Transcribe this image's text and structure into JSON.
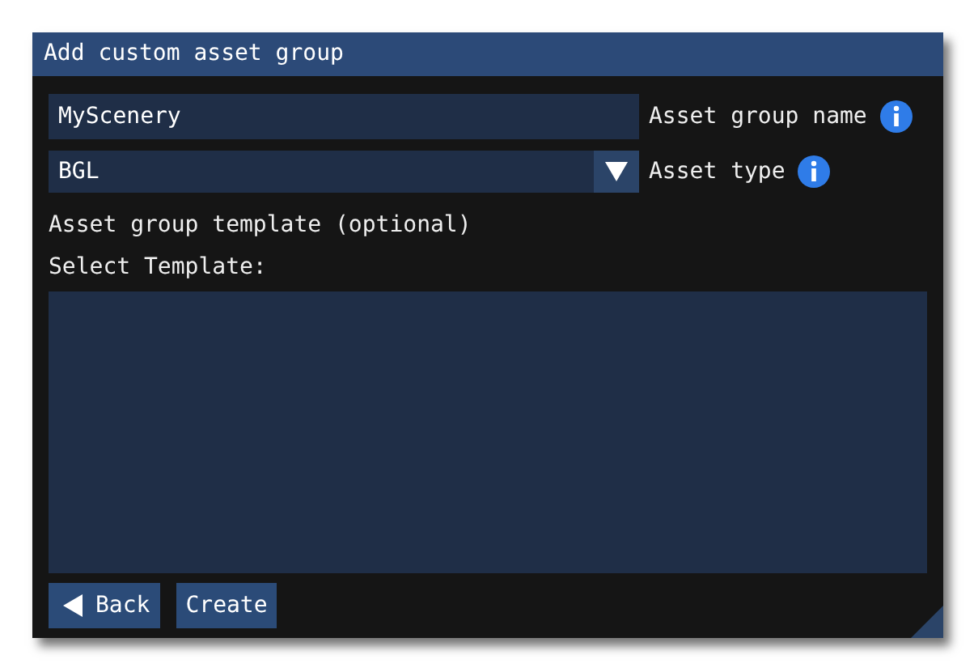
{
  "window": {
    "title": "Add custom asset group"
  },
  "fields": [
    {
      "kind": "text",
      "value": "MyScenery",
      "label": "Asset group name"
    },
    {
      "kind": "dropdown",
      "value": "BGL",
      "label": "Asset type"
    }
  ],
  "template_label": "Asset group template (optional)",
  "select_label": "Select Template:",
  "buttons": [
    {
      "kind": "back",
      "label": "Back"
    },
    {
      "kind": "plain",
      "label": "Create"
    }
  ]
}
